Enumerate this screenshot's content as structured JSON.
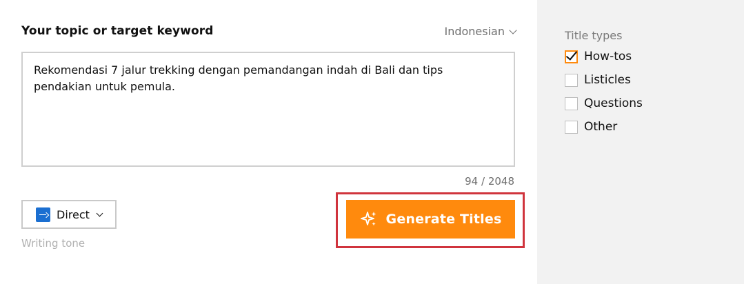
{
  "topic": {
    "label": "Your topic or target keyword",
    "language": "Indonesian",
    "text": "Rekomendasi 7 jalur trekking dengan pemandangan indah di Bali dan tips pendakian untuk pemula.",
    "counter": "94 / 2048"
  },
  "tone": {
    "value": "Direct",
    "caption": "Writing tone"
  },
  "generate": {
    "label": "Generate Titles"
  },
  "title_types": {
    "heading": "Title types",
    "options": [
      {
        "label": "How-tos",
        "checked": true
      },
      {
        "label": "Listicles",
        "checked": false
      },
      {
        "label": "Questions",
        "checked": false
      },
      {
        "label": "Other",
        "checked": false
      }
    ]
  },
  "colors": {
    "accent": "#ff8a0d",
    "highlight_outline": "#d0343d",
    "tone_icon": "#1b6fd1",
    "sidebar_bg": "#f2f2f2"
  }
}
